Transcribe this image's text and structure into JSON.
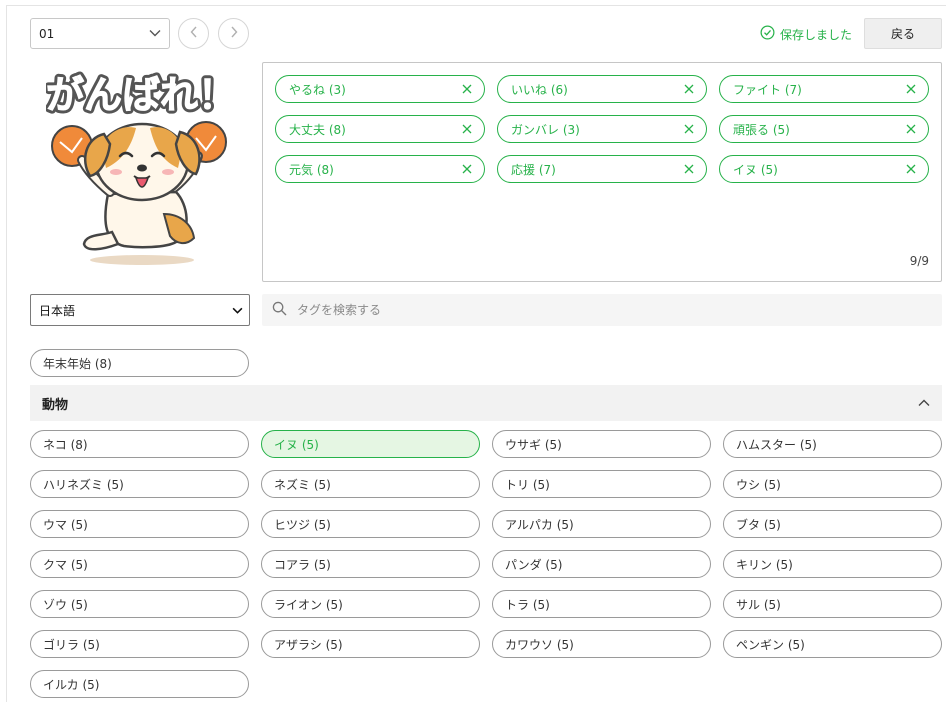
{
  "toolbar": {
    "sticker_number": "01",
    "saved_label": "保存しました",
    "back_label": "戻る"
  },
  "sticker": {
    "caption": "がんばれ！"
  },
  "selected_tags": {
    "items": [
      {
        "label": "やるね (3)"
      },
      {
        "label": "いいね (6)"
      },
      {
        "label": "ファイト (7)"
      },
      {
        "label": "大丈夫 (8)"
      },
      {
        "label": "ガンバレ (3)"
      },
      {
        "label": "頑張る (5)"
      },
      {
        "label": "元気 (8)"
      },
      {
        "label": "応援 (7)"
      },
      {
        "label": "イヌ (5)"
      }
    ],
    "count": "9/9"
  },
  "language": {
    "selected": "日本語"
  },
  "search": {
    "placeholder": "タグを検索する"
  },
  "seasonal_tag": {
    "label": "年末年始 (8)"
  },
  "animals": {
    "title": "動物",
    "tags": [
      {
        "label": "ネコ (8)"
      },
      {
        "label": "イヌ (5)",
        "selected": true
      },
      {
        "label": "ウサギ (5)"
      },
      {
        "label": "ハムスター (5)"
      },
      {
        "label": "ハリネズミ (5)"
      },
      {
        "label": "ネズミ (5)"
      },
      {
        "label": "トリ (5)"
      },
      {
        "label": "ウシ (5)"
      },
      {
        "label": "ウマ (5)"
      },
      {
        "label": "ヒツジ (5)"
      },
      {
        "label": "アルパカ (5)"
      },
      {
        "label": "ブタ (5)"
      },
      {
        "label": "クマ (5)"
      },
      {
        "label": "コアラ (5)"
      },
      {
        "label": "パンダ (5)"
      },
      {
        "label": "キリン (5)"
      },
      {
        "label": "ゾウ (5)"
      },
      {
        "label": "ライオン (5)"
      },
      {
        "label": "トラ (5)"
      },
      {
        "label": "サル (5)"
      },
      {
        "label": "ゴリラ (5)"
      },
      {
        "label": "アザラシ (5)"
      },
      {
        "label": "カワウソ (5)"
      },
      {
        "label": "ペンギン (5)"
      },
      {
        "label": "イルカ (5)"
      }
    ]
  },
  "icons": {
    "dropdown": "chevron-down-icon",
    "prev": "chevron-left-icon",
    "next": "chevron-right-icon",
    "saved": "check-circle-icon",
    "remove": "close-icon",
    "search": "search-icon",
    "collapse": "chevron-up-icon"
  },
  "colors": {
    "accent": "#27b24a",
    "selected_fill": "#e5f6e3"
  }
}
